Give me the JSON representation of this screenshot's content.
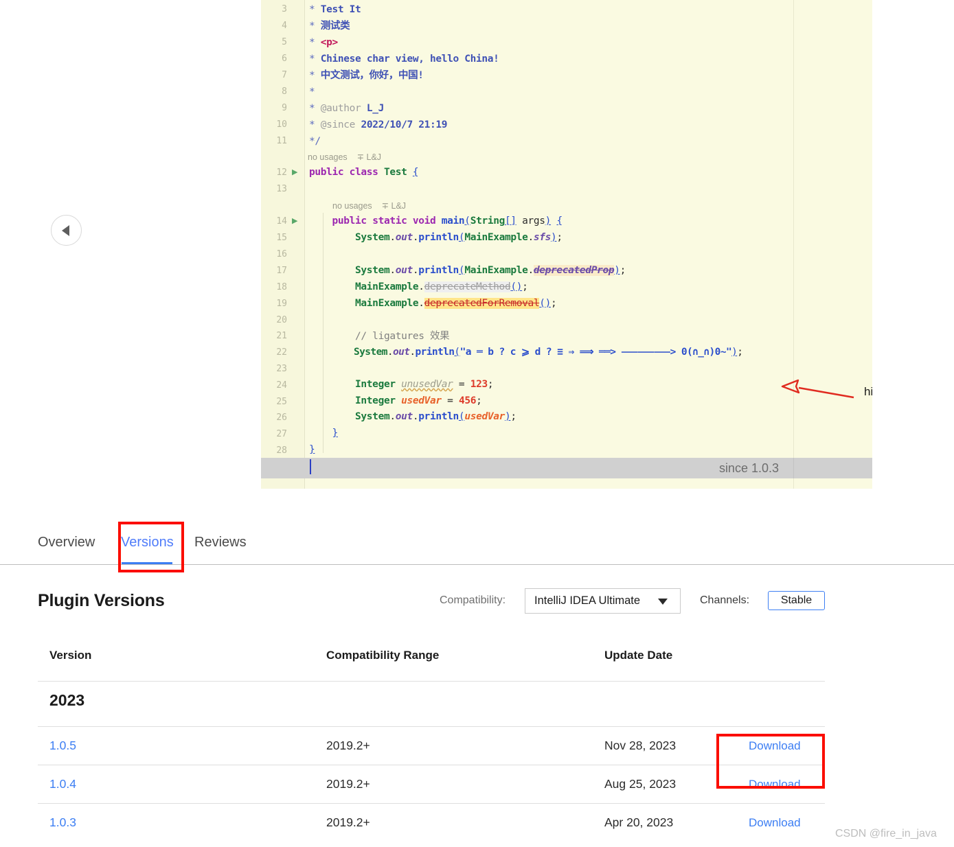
{
  "code_panel": {
    "since_label": "since 1.0.3",
    "annotation": "highlight unused variable",
    "hints": [
      {
        "text": "no usages    ∓ L&J"
      },
      {
        "text": "no usages    ∓ L&J"
      }
    ],
    "lines": [
      {
        "num": "3",
        "text": " * Test It"
      },
      {
        "num": "4",
        "text": " * 测试类"
      },
      {
        "num": "5",
        "text": " * <p>"
      },
      {
        "num": "6",
        "text": " * Chinese char view, hello China!"
      },
      {
        "num": "7",
        "text": " * 中文测试，你好，中国!"
      },
      {
        "num": "8",
        "text": " *"
      },
      {
        "num": "9",
        "text": " * @author L_J"
      },
      {
        "num": "10",
        "text": " * @since 2022/10/7 21:19"
      },
      {
        "num": "11",
        "text": " */"
      },
      {
        "num": "12",
        "text": "public class Test {"
      },
      {
        "num": "13",
        "text": ""
      },
      {
        "num": "14",
        "text": "    public static void main(String[] args) {"
      },
      {
        "num": "15",
        "text": "        System.out.println(MainExample.sfs);"
      },
      {
        "num": "16",
        "text": ""
      },
      {
        "num": "17",
        "text": "        System.out.println(MainExample.deprecatedProp);"
      },
      {
        "num": "18",
        "text": "        MainExample.deprecateMethod();"
      },
      {
        "num": "19",
        "text": "        MainExample.deprecatedForRemoval();"
      },
      {
        "num": "20",
        "text": ""
      },
      {
        "num": "21",
        "text": "        // ligatures 效果"
      },
      {
        "num": "22",
        "text": "        System.out.println(\"a == b ? c >= d ? ≡ ⇒ ⟹ ===> --------------> 0(∩_∩)0~\");"
      },
      {
        "num": "23",
        "text": ""
      },
      {
        "num": "24",
        "text": "        Integer unusedVar = 123;"
      },
      {
        "num": "25",
        "text": "        Integer usedVar = 456;"
      },
      {
        "num": "26",
        "text": "        System.out.println(usedVar);"
      },
      {
        "num": "27",
        "text": "    }"
      },
      {
        "num": "28",
        "text": "}"
      }
    ]
  },
  "prev_button": {
    "icon": "chevron-left-icon"
  },
  "tabs": [
    {
      "label": "Overview",
      "active": false
    },
    {
      "label": "Versions",
      "active": true
    },
    {
      "label": "Reviews",
      "active": false
    }
  ],
  "versions_section": {
    "title": "Plugin Versions",
    "compatibility_label": "Compatibility:",
    "compatibility_value": "IntelliJ IDEA Ultimate",
    "channels_label": "Channels:",
    "channel_value": "Stable"
  },
  "table": {
    "headers": [
      "Version",
      "Compatibility Range",
      "Update Date"
    ],
    "groups": [
      {
        "year": "2023",
        "rows": [
          {
            "version": "1.0.5",
            "range": "2019.2+",
            "date": "Nov 28, 2023",
            "action": "Download"
          },
          {
            "version": "1.0.4",
            "range": "2019.2+",
            "date": "Aug 25, 2023",
            "action": "Download"
          },
          {
            "version": "1.0.3",
            "range": "2019.2+",
            "date": "Apr 20, 2023",
            "action": "Download"
          }
        ]
      }
    ]
  },
  "watermark": "CSDN @fire_in_java",
  "colors": {
    "accent_blue": "#3C7EF3",
    "annotation_red": "#FB0D00",
    "code_bg": "#FAFAE1",
    "gutter_bg": "#F7F7DC"
  }
}
